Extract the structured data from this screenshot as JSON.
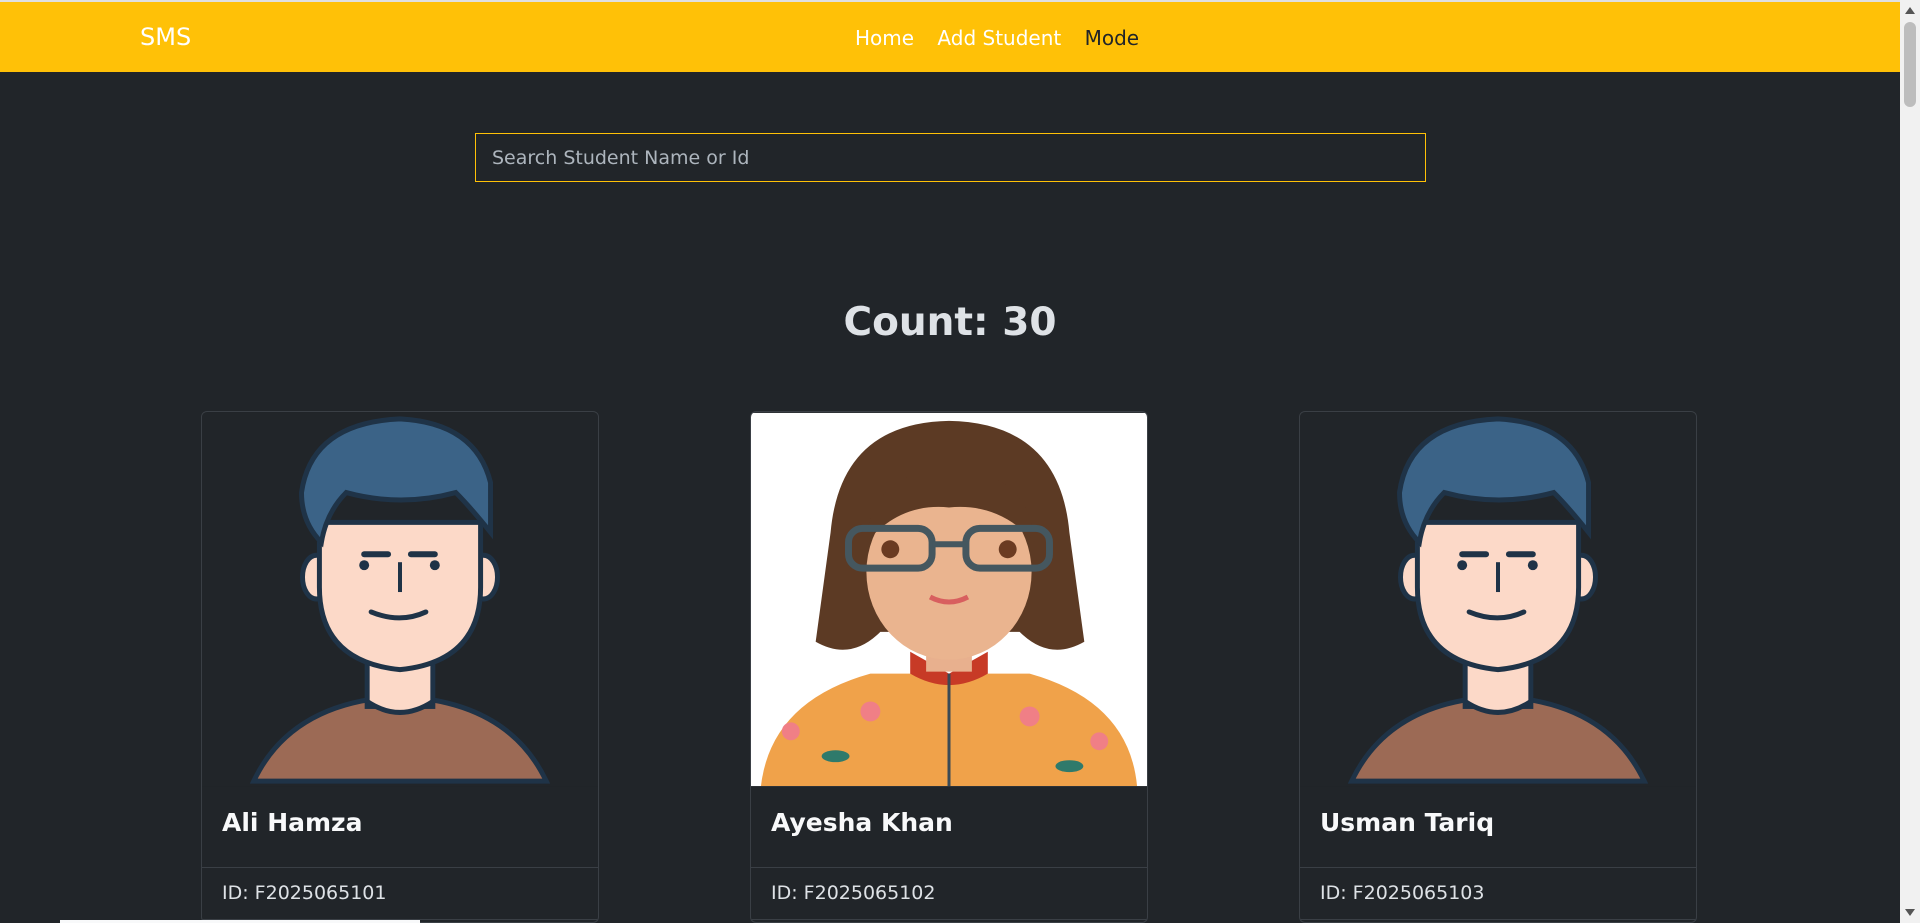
{
  "navbar": {
    "brand": "SMS",
    "links": [
      {
        "label": "Home"
      },
      {
        "label": "Add Student"
      },
      {
        "label": "Mode"
      }
    ],
    "bg_color": "#ffc107"
  },
  "search": {
    "placeholder": "Search Student Name or Id",
    "value": ""
  },
  "count_label": "Count: 30",
  "students": [
    {
      "name": "Ali Hamza",
      "id": "ID: F2025065101",
      "avatar": "male-avatar"
    },
    {
      "name": "Ayesha Khan",
      "id": "ID: F2025065102",
      "avatar": "female-avatar"
    },
    {
      "name": "Usman Tariq",
      "id": "ID: F2025065103",
      "avatar": "male-avatar"
    }
  ]
}
